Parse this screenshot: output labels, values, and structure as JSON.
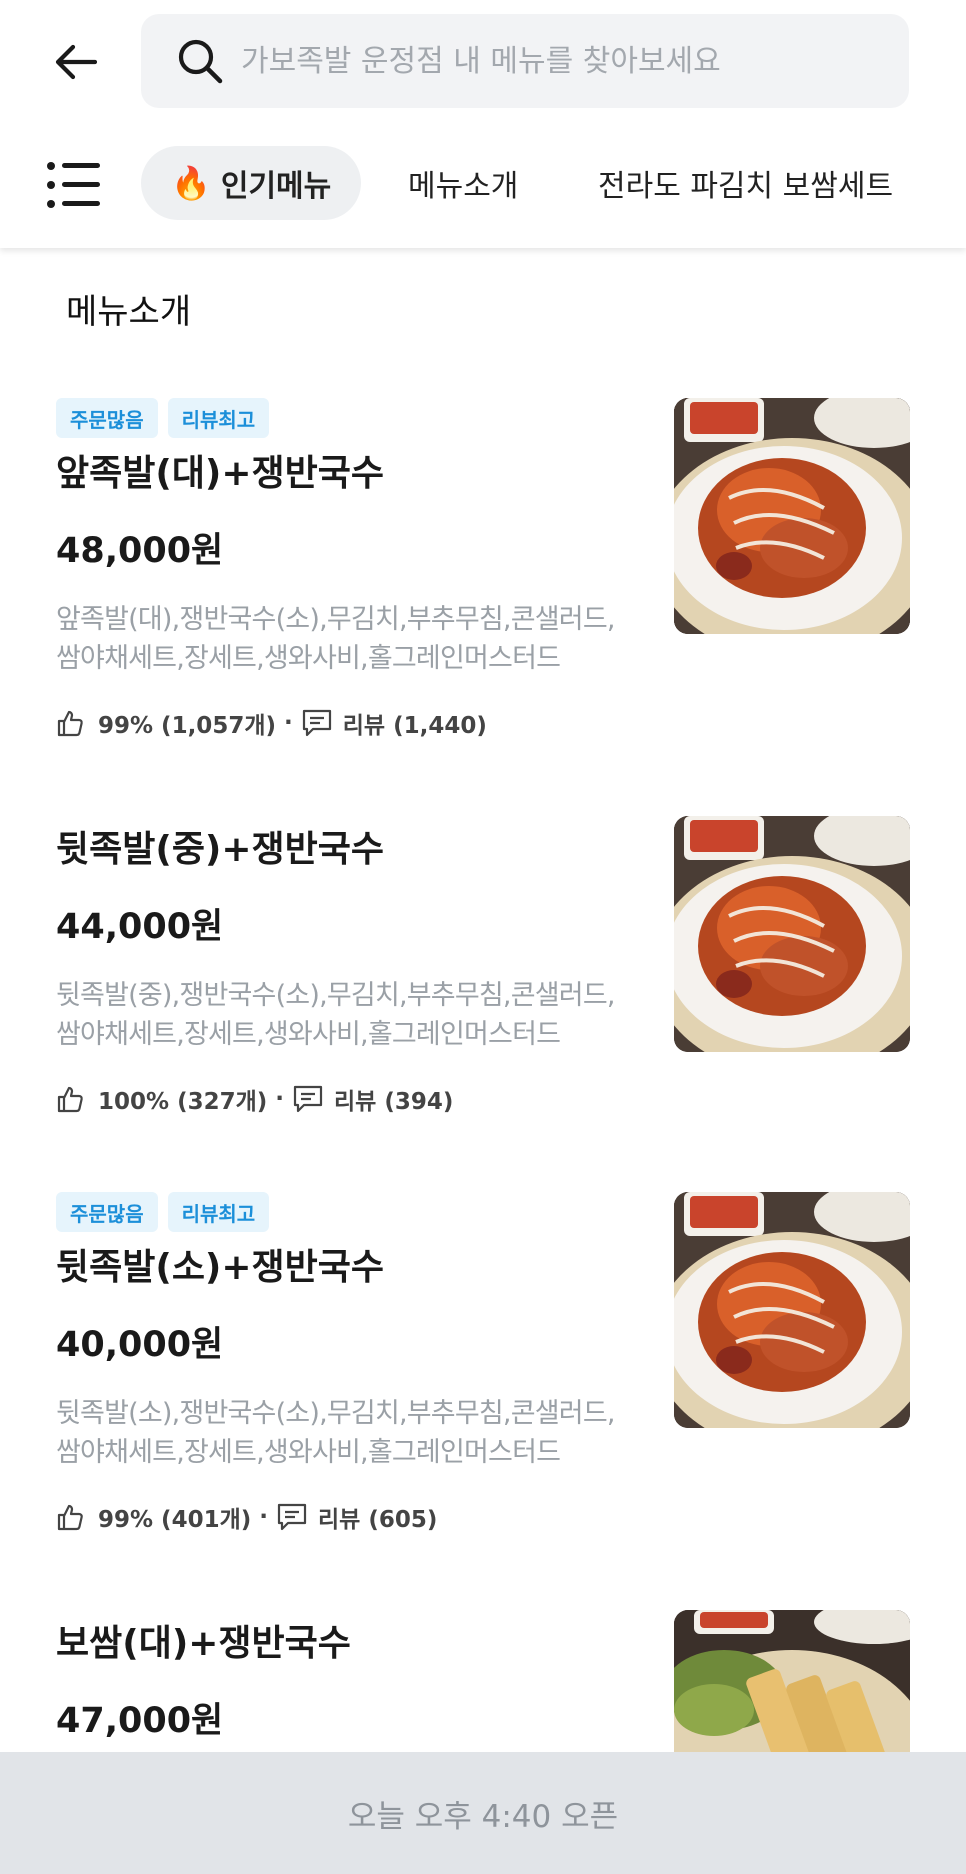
{
  "header": {
    "search_placeholder": "가보족발 운정점 내 메뉴를 찾아보세요"
  },
  "tabs": [
    {
      "label": "인기메뉴",
      "icon": "fire-icon",
      "active": true
    },
    {
      "label": "메뉴소개",
      "active": false
    },
    {
      "label": "전라도 파김치 보쌈세트",
      "active": false
    }
  ],
  "section_title": "메뉴소개",
  "items": [
    {
      "badges": [
        "주문많음",
        "리뷰최고"
      ],
      "name": "앞족발(대)+쟁반국수",
      "price": "48,000원",
      "desc": "앞족발(대),쟁반국수(소),무김치,부추무침,콘샐러드,쌈야채세트,장세트,생와사비,홀그레인머스터드",
      "rating": "99% (1,057개)",
      "reviews": "리뷰 (1,440)",
      "photo": "jokbal-photo"
    },
    {
      "badges": [],
      "name": "뒷족발(중)+쟁반국수",
      "price": "44,000원",
      "desc": "뒷족발(중),쟁반국수(소),무김치,부추무침,콘샐러드,쌈야채세트,장세트,생와사비,홀그레인머스터드",
      "rating": "100% (327개)",
      "reviews": "리뷰 (394)",
      "photo": "jokbal-photo"
    },
    {
      "badges": [
        "주문많음",
        "리뷰최고"
      ],
      "name": "뒷족발(소)+쟁반국수",
      "price": "40,000원",
      "desc": "뒷족발(소),쟁반국수(소),무김치,부추무침,콘샐러드,쌈야채세트,장세트,생와사비,홀그레인머스터드",
      "rating": "99% (401개)",
      "reviews": "리뷰 (605)",
      "photo": "jokbal-photo"
    },
    {
      "badges": [],
      "name": "보쌈(대)+쟁반국수",
      "price": "47,000원",
      "photo": "bossam-photo"
    }
  ],
  "bottom_bar": {
    "label": "오늘 오후 4:40 오픈"
  },
  "colors": {
    "badge_bg": "#e6f4fc",
    "badge_text": "#1c8fd9",
    "tab_active_bg": "#eef0f2",
    "bottom_bar_bg": "#e1e4e8",
    "desc_text": "#9aa0a6"
  }
}
